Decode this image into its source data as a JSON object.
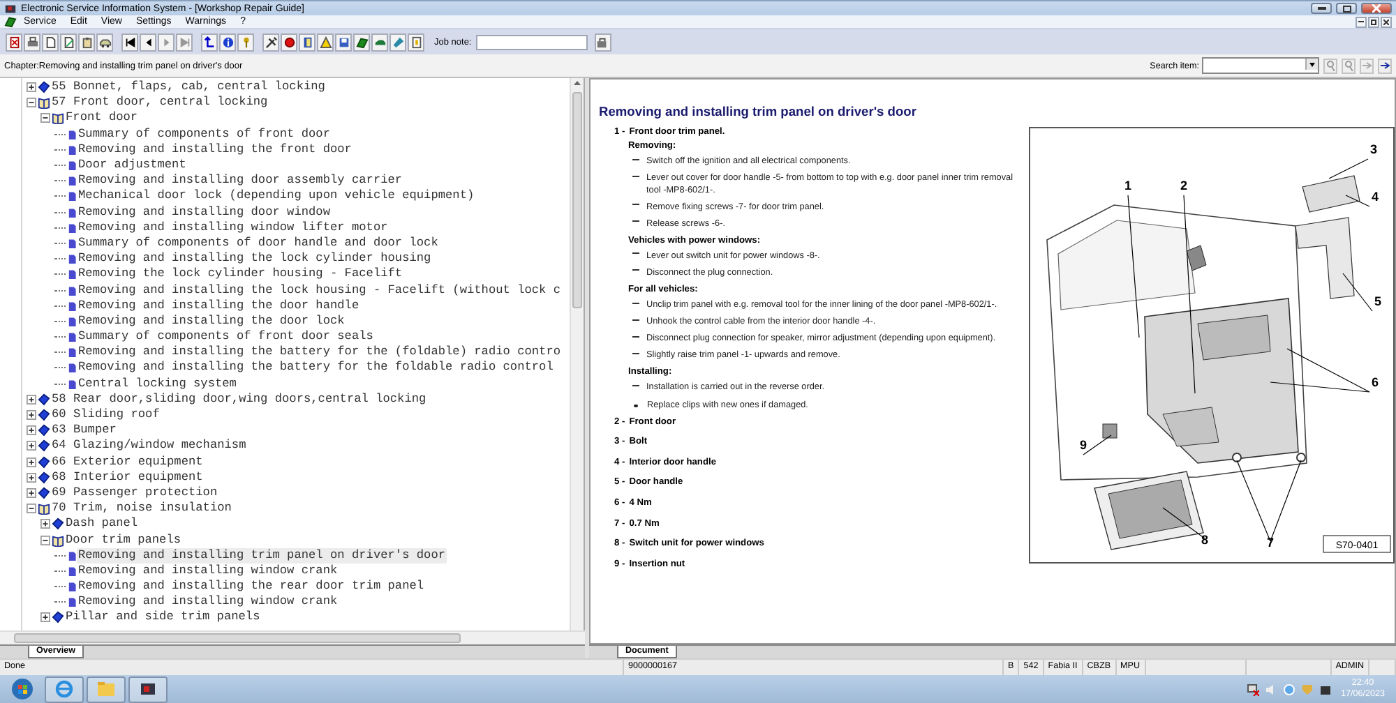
{
  "window": {
    "title": "Electronic Service Information System - [Workshop Repair Guide]"
  },
  "menu": [
    "Service",
    "Edit",
    "View",
    "Settings",
    "Warnings",
    "?"
  ],
  "toolbar": {
    "job_note_label": "Job note:"
  },
  "chapter": "Chapter:Removing and installing trim panel on driver's door",
  "search": {
    "label": "Search item:"
  },
  "tree": [
    {
      "label": "55 Bonnet, flaps, cab, central locking",
      "kind": "book",
      "expanded": false,
      "selected": false
    },
    {
      "label": "57 Front door, central locking",
      "kind": "book",
      "expanded": true,
      "selected": false,
      "children": [
        {
          "label": "Front door",
          "kind": "book",
          "expanded": true,
          "selected": false,
          "children": [
            {
              "label": "Summary of components of front door",
              "kind": "page",
              "selected": false
            },
            {
              "label": "Removing and installing the front door",
              "kind": "page",
              "selected": false
            },
            {
              "label": "Door adjustment",
              "kind": "page",
              "selected": false
            },
            {
              "label": "Removing and installing door assembly carrier",
              "kind": "page",
              "selected": false
            },
            {
              "label": "Mechanical door lock (depending upon vehicle equipment)",
              "kind": "page",
              "selected": false
            },
            {
              "label": "Removing and installing door window",
              "kind": "page",
              "selected": false
            },
            {
              "label": "Removing and installing window lifter motor",
              "kind": "page",
              "selected": false
            },
            {
              "label": "Summary of components of door handle and door lock",
              "kind": "page",
              "selected": false
            },
            {
              "label": "Removing and installing the lock cylinder housing",
              "kind": "page",
              "selected": false
            },
            {
              "label": "Removing the lock cylinder housing - Facelift",
              "kind": "page",
              "selected": false
            },
            {
              "label": "Removing and installing the lock housing - Facelift (without lock c",
              "kind": "page",
              "selected": false
            },
            {
              "label": "Removing and installing the door handle",
              "kind": "page",
              "selected": false
            },
            {
              "label": "Removing and installing the door lock",
              "kind": "page",
              "selected": false
            },
            {
              "label": "Summary of components of front door seals",
              "kind": "page",
              "selected": false
            },
            {
              "label": "Removing and installing the battery for the (foldable) radio contro",
              "kind": "page",
              "selected": false
            },
            {
              "label": "Removing and installing the battery for the foldable radio control",
              "kind": "page",
              "selected": false
            },
            {
              "label": "Central locking system",
              "kind": "page",
              "selected": false
            }
          ]
        }
      ]
    },
    {
      "label": "58 Rear door,sliding door,wing doors,central locking",
      "kind": "book",
      "expanded": false,
      "selected": false
    },
    {
      "label": "60 Sliding roof",
      "kind": "book",
      "expanded": false,
      "selected": false
    },
    {
      "label": "63 Bumper",
      "kind": "book",
      "expanded": false,
      "selected": false
    },
    {
      "label": "64 Glazing/window mechanism",
      "kind": "book",
      "expanded": false,
      "selected": false
    },
    {
      "label": "66 Exterior equipment",
      "kind": "book",
      "expanded": false,
      "selected": false
    },
    {
      "label": "68 Interior equipment",
      "kind": "book",
      "expanded": false,
      "selected": false
    },
    {
      "label": "69 Passenger protection",
      "kind": "book",
      "expanded": false,
      "selected": false
    },
    {
      "label": "70 Trim, noise insulation",
      "kind": "book",
      "expanded": true,
      "selected": false,
      "children": [
        {
          "label": "Dash panel",
          "kind": "book",
          "expanded": false,
          "selected": false
        },
        {
          "label": "Door trim panels",
          "kind": "book",
          "expanded": true,
          "selected": false,
          "children": [
            {
              "label": "Removing and installing trim panel on driver's door",
              "kind": "page",
              "selected": true
            },
            {
              "label": "Removing and installing window crank",
              "kind": "page",
              "selected": false
            },
            {
              "label": "Removing and installing the rear door trim panel",
              "kind": "page",
              "selected": false
            },
            {
              "label": "Removing and installing window crank",
              "kind": "page",
              "selected": false
            }
          ]
        },
        {
          "label": "Pillar and side trim panels",
          "kind": "book",
          "expanded": false,
          "selected": false
        }
      ]
    }
  ],
  "left_tabs": [
    {
      "label": "Overview",
      "selected": true
    }
  ],
  "document": {
    "title": "Removing and installing trim panel on driver's door",
    "items": [
      {
        "number": "1 -",
        "title": "Front door trim panel.",
        "sections": [
          {
            "heading": "Removing:",
            "steps": [
              {
                "kind": "dash",
                "text": "Switch off the ignition and all electrical components."
              },
              {
                "kind": "dash",
                "text": "Lever out cover for door handle -5- from bottom to top with e.g. door panel inner trim removal tool -MP8-602/1-."
              },
              {
                "kind": "dash",
                "text": "Remove fixing screws -7- for door trim panel."
              },
              {
                "kind": "dash",
                "text": "Release screws -6-."
              }
            ]
          },
          {
            "heading": "Vehicles with power windows:",
            "steps": [
              {
                "kind": "dash",
                "text": "Lever out switch unit for power windows -8-."
              },
              {
                "kind": "dash",
                "text": "Disconnect the plug connection."
              }
            ]
          },
          {
            "heading": "For all vehicles:",
            "steps": [
              {
                "kind": "dash",
                "text": "Unclip trim panel with e.g. removal tool for the inner lining of the door panel -MP8-602/1-."
              },
              {
                "kind": "dash",
                "text": "Unhook the control cable from the interior door handle -4-."
              },
              {
                "kind": "dash",
                "text": "Disconnect plug connection for speaker, mirror adjustment (depending upon equipment)."
              },
              {
                "kind": "dash",
                "text": "Slightly raise trim panel -1- upwards and remove."
              }
            ]
          },
          {
            "heading": "Installing:",
            "steps": [
              {
                "kind": "dash",
                "text": "Installation is carried out in the reverse order."
              },
              {
                "kind": "bullet",
                "text": "Replace clips with new ones if damaged."
              }
            ]
          }
        ]
      },
      {
        "number": "2 -",
        "title": "Front door"
      },
      {
        "number": "3 -",
        "title": "Bolt"
      },
      {
        "number": "4 -",
        "title": "Interior door handle"
      },
      {
        "number": "5 -",
        "title": "Door handle"
      },
      {
        "number": "6 -",
        "title": "4 Nm"
      },
      {
        "number": "7 -",
        "title": "0.7 Nm"
      },
      {
        "number": "8 -",
        "title": "Switch unit for power windows"
      },
      {
        "number": "9 -",
        "title": "Insertion nut"
      }
    ]
  },
  "figure": {
    "callouts": [
      "1",
      "2",
      "3",
      "4",
      "5",
      "6",
      "7",
      "8",
      "9"
    ],
    "code": "S70-0401"
  },
  "right_tabs": [
    {
      "label": "Document",
      "selected": true
    }
  ],
  "status_bar": [
    "Done",
    "9000000167",
    "B",
    "542",
    "Fabia II",
    "CBZB",
    "MPU",
    "ADMIN"
  ],
  "taskbar": {
    "time": "22:40",
    "date": "17/06/2023"
  }
}
